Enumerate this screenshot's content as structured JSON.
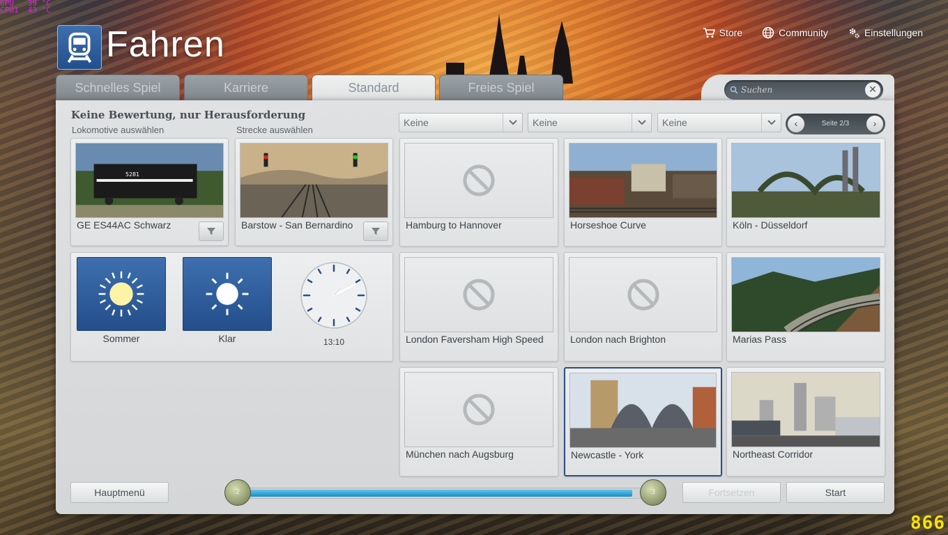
{
  "debug": {
    "gpu_label": "GPU",
    "gpu_value": "39 °C",
    "cpu_label": "CPU1",
    "cpu_value": "43 °C",
    "fps": "866"
  },
  "header": {
    "title": "Fahren",
    "nav": [
      {
        "label": "Store",
        "icon": "cart-icon"
      },
      {
        "label": "Community",
        "icon": "globe-icon"
      },
      {
        "label": "Einstellungen",
        "icon": "gear-icon"
      }
    ]
  },
  "tabs": [
    {
      "label": "Schnelles Spiel",
      "active": false
    },
    {
      "label": "Karriere",
      "active": false
    },
    {
      "label": "Standard",
      "active": true
    },
    {
      "label": "Freies Spiel",
      "active": false
    }
  ],
  "search": {
    "placeholder": "Suchen"
  },
  "left": {
    "heading": "Keine Bewertung, nur Herausforderung",
    "loco_label": "Lokomotive auswählen",
    "route_label": "Strecke auswählen",
    "loco_name": "GE ES44AC Schwarz",
    "route_name": "Barstow - San Bernardino",
    "season": "Sommer",
    "weather": "Klar",
    "time": "13:10"
  },
  "filters": [
    {
      "value": "Keine"
    },
    {
      "value": "Keine"
    },
    {
      "value": "Keine"
    }
  ],
  "pager": {
    "text": "Seite 2/3"
  },
  "scenarios": [
    {
      "name": "Hamburg to Hannover",
      "image": "no-image-icon"
    },
    {
      "name": "Horseshoe Curve",
      "image": "city-rail-yard"
    },
    {
      "name": "Köln - Düsseldorf",
      "image": "bridge-cathedral"
    },
    {
      "name": "London Faversham High Speed",
      "image": "no-image-icon"
    },
    {
      "name": "London nach Brighton",
      "image": "no-image-icon"
    },
    {
      "name": "Marias Pass",
      "image": "mountain-track"
    },
    {
      "name": "München nach Augsburg",
      "image": "no-image-icon"
    },
    {
      "name": "Newcastle - York",
      "image": "station-arches",
      "selected": true
    },
    {
      "name": "Northeast Corridor",
      "image": "skyline-train"
    }
  ],
  "footer": {
    "main_menu": "Hauptmenü",
    "continue": "Fortsetzen",
    "start": "Start",
    "slider_min_label": "2",
    "slider_max_label": "3",
    "slider_fill": 0.95
  },
  "colors": {
    "accent": "#2d4f86",
    "tile_blue": "#3f6fae",
    "slider": "#1d8cc4",
    "fps": "#f5e400",
    "debug": "#e020e0"
  }
}
